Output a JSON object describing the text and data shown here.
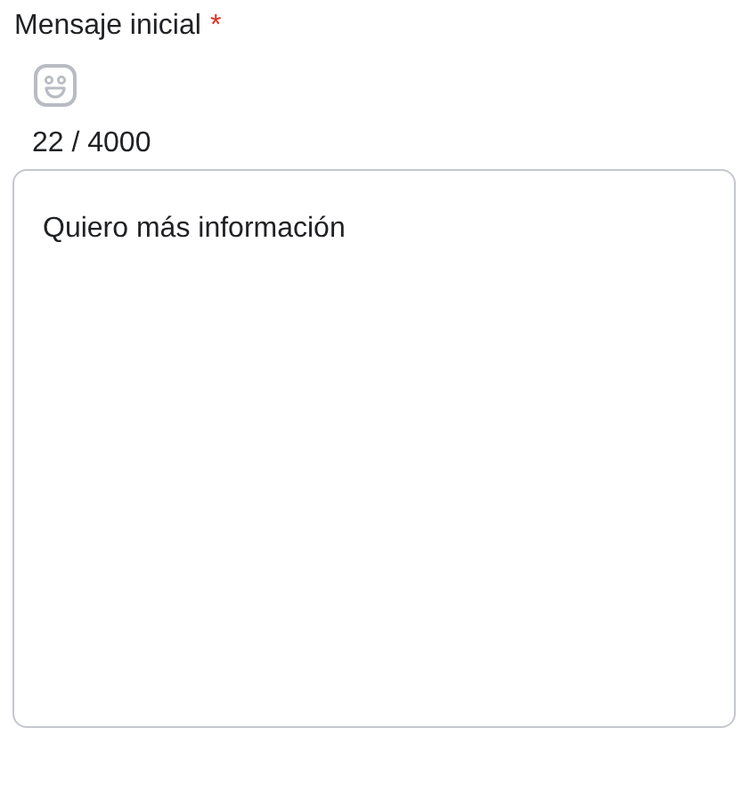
{
  "field": {
    "label": "Mensaje inicial",
    "required_mark": "*",
    "counter": "22 / 4000",
    "value": "Quiero más información"
  }
}
